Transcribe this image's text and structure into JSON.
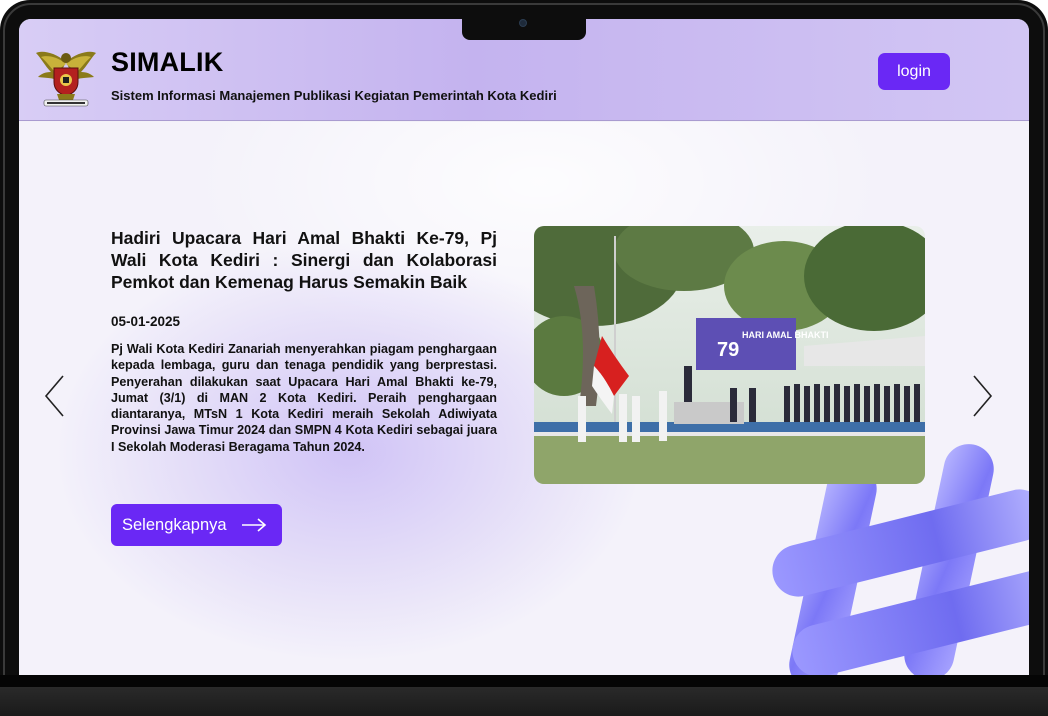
{
  "header": {
    "app_title": "SIMALIK",
    "app_subtitle": "Sistem Informasi Manajemen Publikasi Kegiatan Pemerintah Kota Kediri",
    "login_label": "login",
    "logo_icon": "garuda-emblem-icon"
  },
  "slide": {
    "title": "Hadiri Upacara Hari Amal Bhakti Ke-79, Pj Wali Kota Kediri : Sinergi dan Kolaborasi Pemkot dan Kemenag Harus Semakin Baik",
    "date": "05-01-2025",
    "body": "Pj Wali Kota Kediri Zanariah menyerahkan piagam penghargaan kepada lembaga, guru dan tenaga pendidik yang berprestasi. Penyerahan dilakukan saat Upacara Hari Amal Bhakti ke-79, Jumat (3/1) di MAN 2 Kota Kediri. Peraih penghargaan diantaranya, MTsN 1 Kota Kediri meraih Sekolah Adiwiyata Provinsi Jawa Timur 2024 dan SMPN 4 Kota Kediri sebagai juara I Sekolah Moderasi Beragama Tahun 2024.",
    "more_label": "Selengkapnya",
    "banner_text": "HARI AMAL BHAKTI",
    "banner_number": "79"
  },
  "nav": {
    "prev_icon": "chevron-left-icon",
    "next_icon": "chevron-right-icon",
    "more_icon": "arrow-right-icon"
  },
  "colors": {
    "accent": "#6a28f5",
    "header_bg": "#c9b9f1",
    "text": "#111111"
  }
}
